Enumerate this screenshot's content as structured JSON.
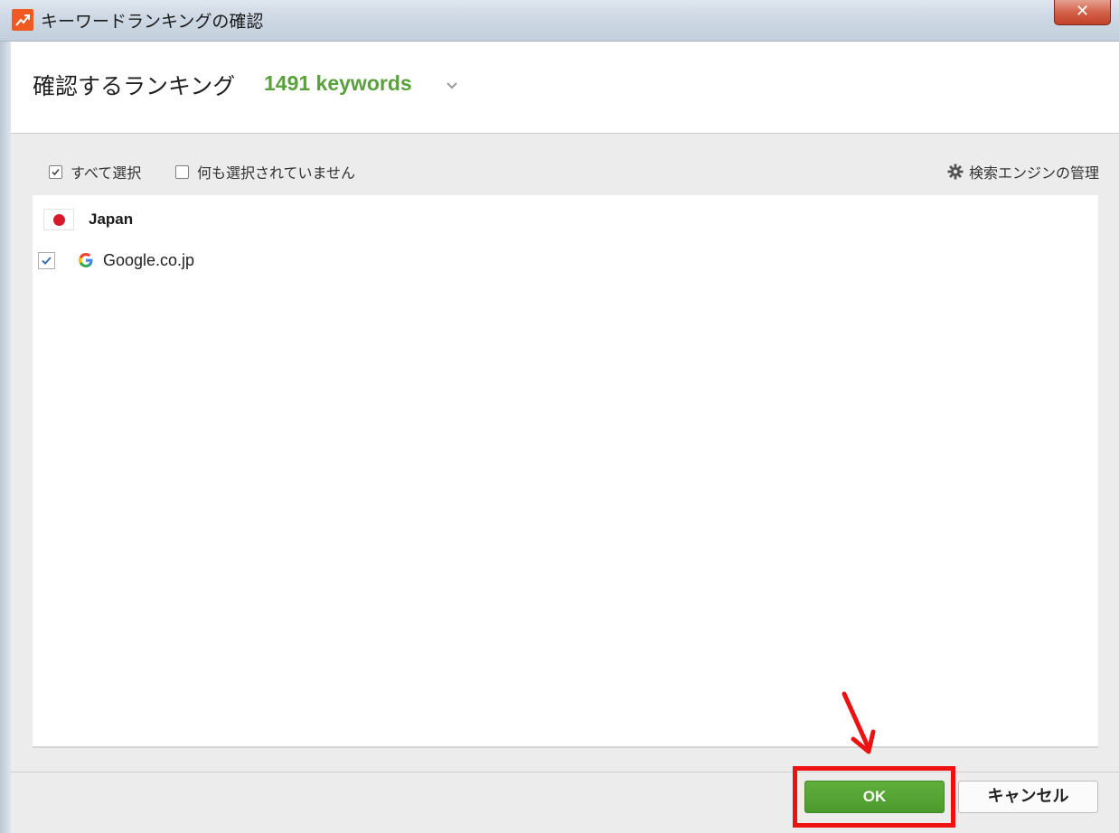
{
  "window": {
    "title": "キーワードランキングの確認",
    "close_label": "✕"
  },
  "header": {
    "title": "確認するランキング",
    "keyword_count": "1491 keywords"
  },
  "toolbar": {
    "select_all_label": "すべて選択",
    "select_none_label": "何も選択されていません",
    "manage_engines_label": "検索エンジンの管理"
  },
  "list": {
    "country": "Japan",
    "engines": [
      {
        "name": "Google.co.jp",
        "checked": true
      }
    ]
  },
  "footer": {
    "ok_label": "OK",
    "cancel_label": "キャンセル"
  },
  "colors": {
    "accent_green": "#5aa03d",
    "ok_button": "#4c9a2d",
    "highlight_red": "#ee1111",
    "app_icon": "#f05a22"
  },
  "icons": {
    "app": "app-trend-icon",
    "gear": "gear-icon",
    "google": "google-g-icon",
    "flag": "japan-flag-icon",
    "dropdown": "chevron-down-icon"
  }
}
